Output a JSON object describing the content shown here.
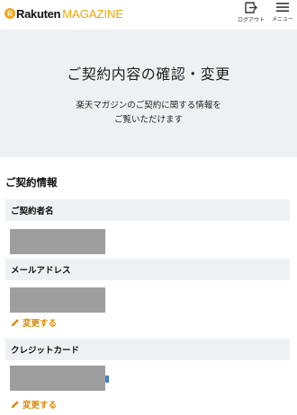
{
  "header": {
    "logo_main": "Rakuten",
    "logo_sub": "MAGAZINE",
    "logout_label": "ログアウト",
    "menu_label": "メニュー"
  },
  "banner": {
    "title": "ご契約内容の確認・変更",
    "desc_line1": "楽天マガジンのご契約に関する情報を",
    "desc_line2": "ご覧いただけます"
  },
  "section": {
    "title": "ご契約情報",
    "fields": [
      {
        "label": "ご契約者名"
      },
      {
        "label": "メールアドレス",
        "action": "変更する"
      },
      {
        "label": "クレジットカード",
        "action": "変更する"
      }
    ]
  },
  "colors": {
    "accent": "#e08a00",
    "banner_bg": "#eef0f3",
    "redacted": "#9e9e9e"
  }
}
